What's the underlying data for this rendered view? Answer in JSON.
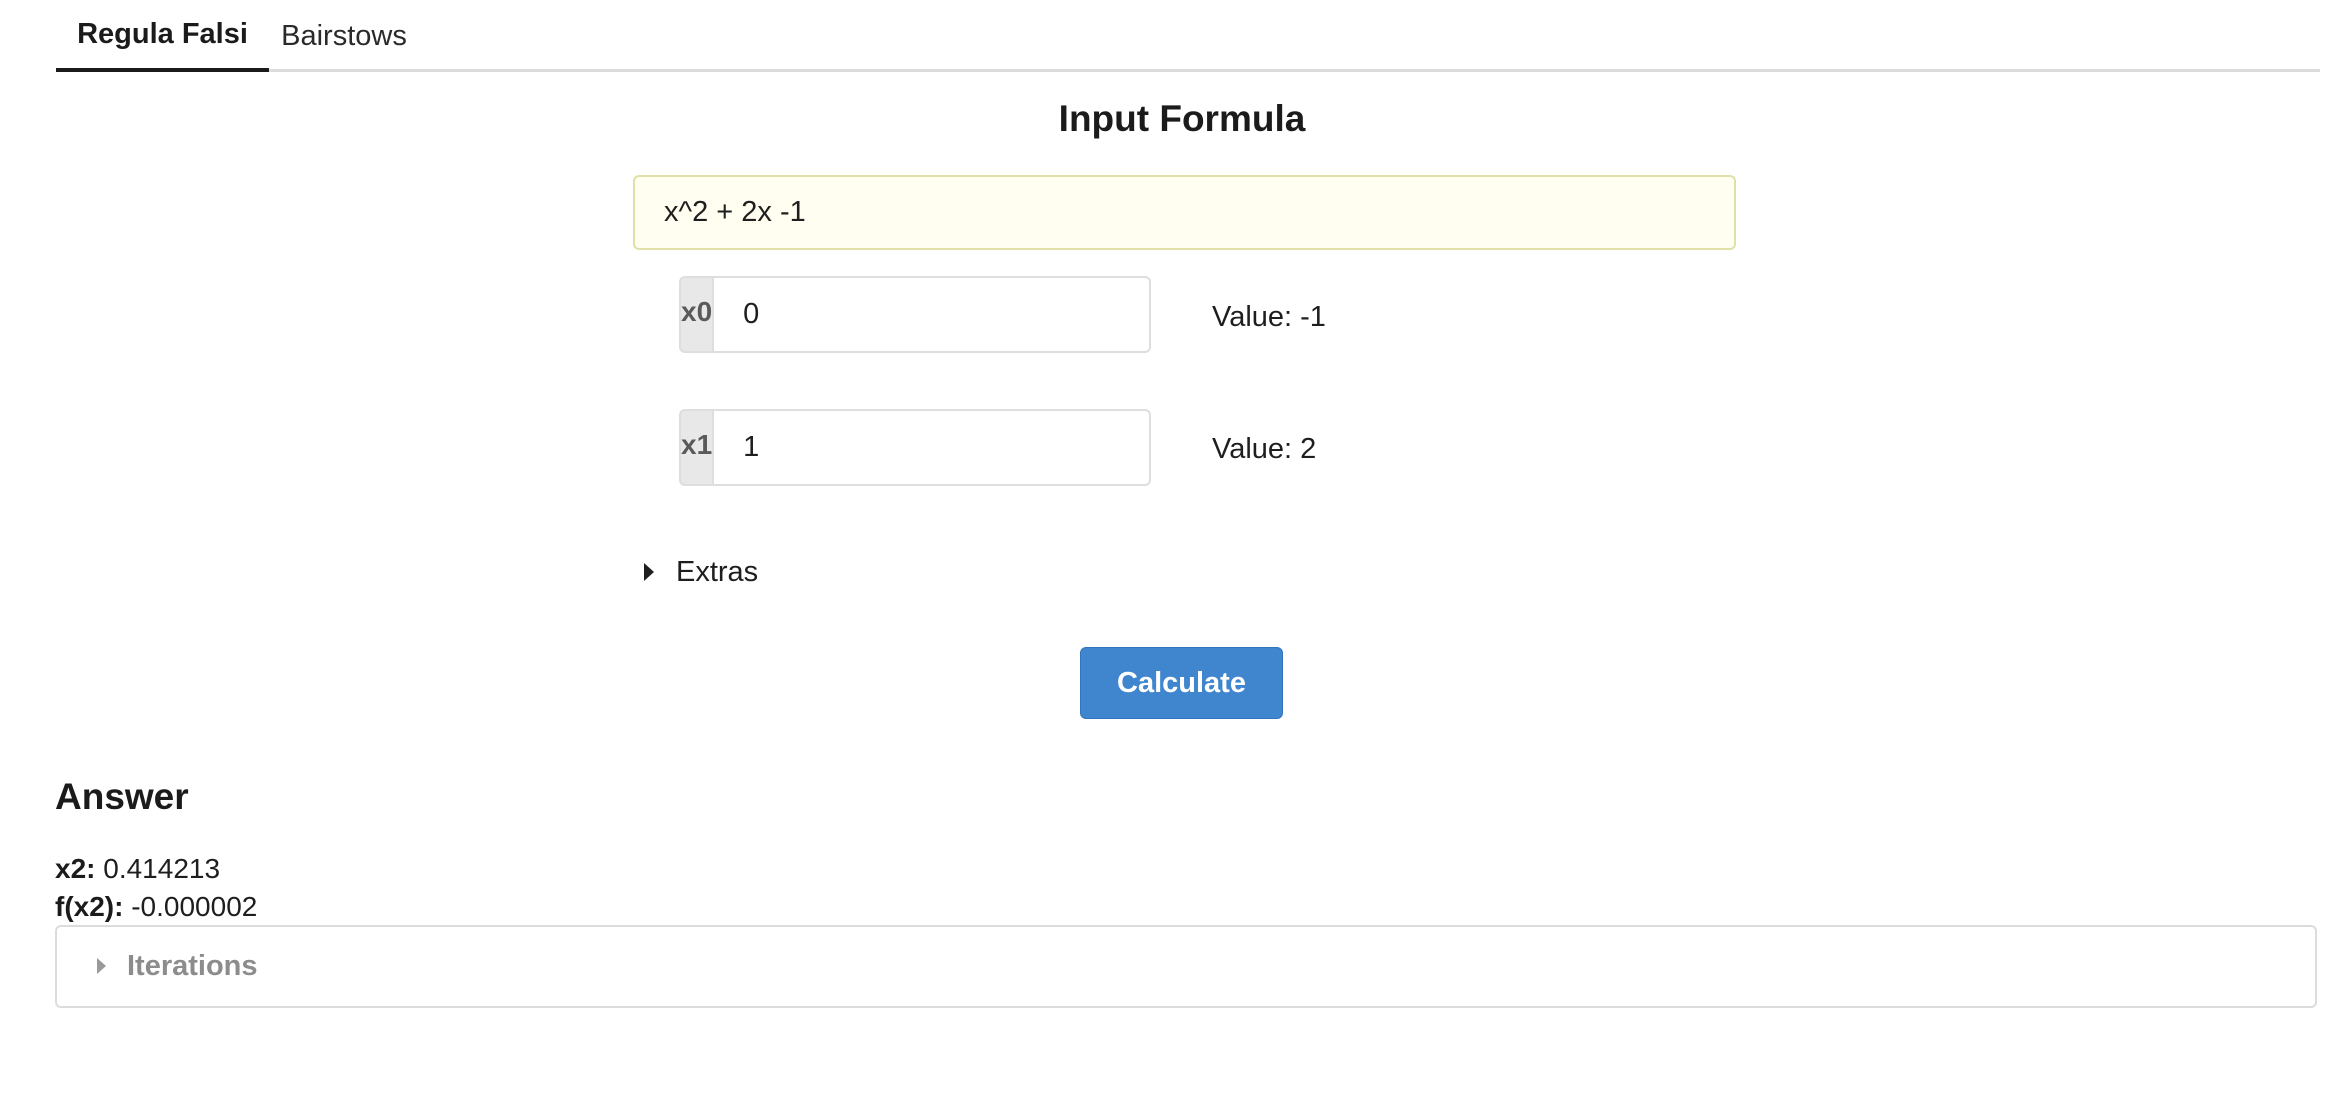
{
  "tabs": [
    {
      "label": "Regula Falsi",
      "active": true
    },
    {
      "label": "Bairstows",
      "active": false
    }
  ],
  "input_section": {
    "title": "Input Formula",
    "formula_value": "x^2 + 2x -1"
  },
  "guesses": [
    {
      "label": "x0",
      "value": "0",
      "result": "Value: -1"
    },
    {
      "label": "x1",
      "value": "1",
      "result": "Value: 2"
    }
  ],
  "extras": {
    "label": "Extras",
    "expanded": false
  },
  "calculate_button": {
    "label": "Calculate",
    "color": "#3f86cf"
  },
  "answer": {
    "title": "Answer",
    "x2_label": "x2:",
    "x2_value": "0.414213",
    "fx2_label": "f(x2):",
    "fx2_value": "-0.000002"
  },
  "iterations": {
    "label": "Iterations",
    "expanded": false
  },
  "colors": {
    "formula_background": "#fffef0",
    "primary": "#3f86cf"
  }
}
